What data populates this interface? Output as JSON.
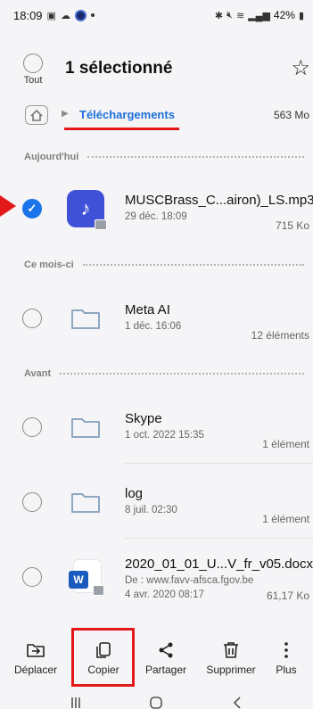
{
  "status": {
    "time": "18:09",
    "battery": "42%"
  },
  "header": {
    "select_all_label": "Tout",
    "title": "1 sélectionné"
  },
  "breadcrumb": {
    "current": "Téléchargements",
    "size": "563 Mo"
  },
  "sections": {
    "today": "Aujourd'hui",
    "this_month": "Ce mois-ci",
    "before": "Avant"
  },
  "files": [
    {
      "name": "MUSCBrass_C...airon)_LS.mp3",
      "date": "29 déc. 18:09",
      "meta": "715 Ko",
      "selected": true,
      "icon": "music-file-icon"
    },
    {
      "name": "Meta AI",
      "date": "1 déc. 16:06",
      "meta": "12 éléments",
      "selected": false,
      "icon": "folder-icon"
    },
    {
      "name": "Skype",
      "date": "1 oct. 2022 15:35",
      "meta": "1 élément",
      "selected": false,
      "icon": "folder-icon"
    },
    {
      "name": "log",
      "date": "8 juil. 02:30",
      "meta": "1 élément",
      "selected": false,
      "icon": "folder-icon"
    },
    {
      "name": "2020_01_01_U...V_fr_v05.docx",
      "source": "De : www.favv-afsca.fgov.be",
      "date": "4 avr. 2020 08:17",
      "meta": "61,17 Ko",
      "selected": false,
      "icon": "word-file-icon"
    }
  ],
  "actions": {
    "move": "Déplacer",
    "copy": "Copier",
    "share": "Partager",
    "delete": "Supprimer",
    "more": "Plus"
  },
  "colors": {
    "accent": "#1a73e8",
    "annotation": "#e31818"
  }
}
